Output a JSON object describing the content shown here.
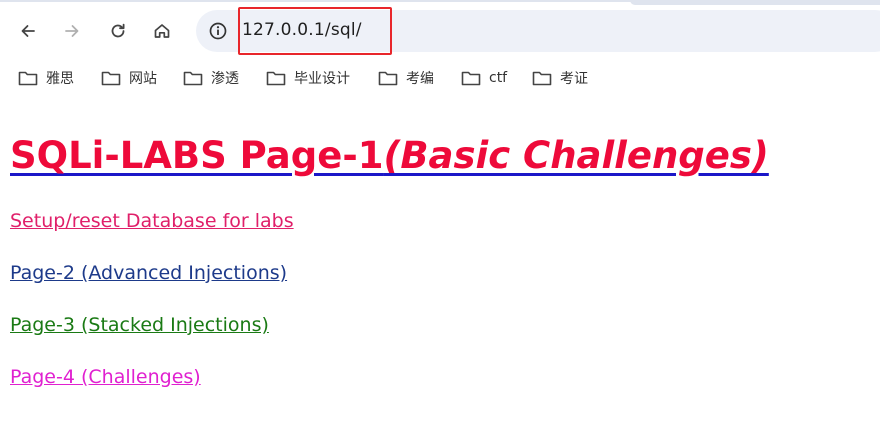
{
  "browser": {
    "url": "127.0.0.1/sql/",
    "nav": {
      "back": "arrow-left-icon",
      "forward": "arrow-right-icon",
      "reload": "reload-icon",
      "home": "home-icon",
      "site_info": "info-icon"
    }
  },
  "bookmarks": [
    {
      "label": "雅思"
    },
    {
      "label": "网站"
    },
    {
      "label": "渗透"
    },
    {
      "label": "毕业设计"
    },
    {
      "label": "考编"
    },
    {
      "label": "ctf"
    },
    {
      "label": "考证"
    }
  ],
  "page": {
    "title_main": "SQLi-LABS Page-1",
    "title_sub": "(Basic Challenges)",
    "links": {
      "setup": "Setup/reset Database for labs",
      "page2": "Page-2 (Advanced Injections)",
      "page3": "Page-3 (Stacked Injections)",
      "page4": "Page-4 (Challenges)"
    }
  },
  "colors": {
    "title": "#ee0a3a",
    "title_underline": "#1b17c8",
    "setup_link": "#e0206a",
    "page2_link": "#1d3a8a",
    "page3_link": "#1a7a14",
    "page4_link": "#e020d0",
    "annotation_box": "#e8262b"
  }
}
